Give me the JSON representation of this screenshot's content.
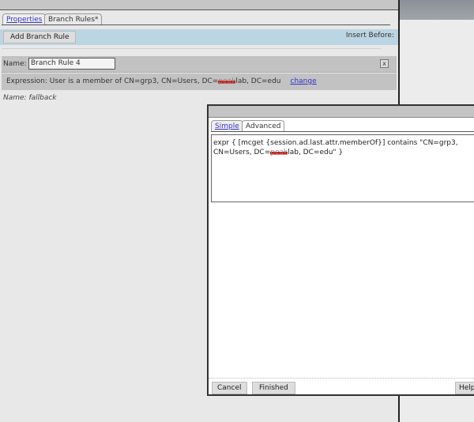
{
  "tabs": [
    {
      "label": "Properties"
    },
    {
      "label": "Branch Rules*"
    }
  ],
  "toolbar": {
    "add_label": "Add Branch Rule",
    "insert_before_label": "Insert Before:"
  },
  "rule": {
    "name_label": "Name:",
    "name_value": "Branch Rule 4",
    "close_label": "x",
    "expression_prefix": "Expression: User is a member of CN=grp3, CN=Users, DC=",
    "expression_redacted": "peak",
    "expression_suffix": "lab, DC=edu",
    "change_label": "change"
  },
  "fallback": {
    "label": "Name: fallback"
  },
  "dialog": {
    "tabs": [
      {
        "label": "Simple"
      },
      {
        "label": "Advanced"
      }
    ],
    "expr_prefix": "expr { [mcget {session.ad.last.attr.memberOf}] contains \"CN=grp3, CN=Users, DC=",
    "expr_redacted": "peak",
    "expr_suffix": "lab, DC=edu\" }",
    "cancel_label": "Cancel",
    "finished_label": "Finished",
    "help_label": "Help"
  }
}
